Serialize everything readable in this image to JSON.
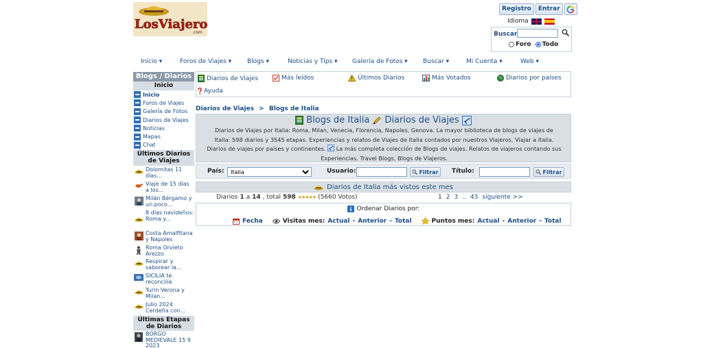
{
  "header": {
    "logo_text": "LosViajeros",
    "logo_sub": ".com",
    "registro": "Registro",
    "entrar": "Entrar",
    "idioma": "Idioma",
    "search_label": "Buscar",
    "search_value": "",
    "radio_foro": "Foro",
    "radio_todo": "Todo"
  },
  "topnav": [
    "Inicio ▾",
    "Foros de Viajes ▾",
    "Blogs ▾",
    "Noticias y Tips ▾",
    "Galería de Fotos ▾",
    "Buscar ▾",
    "Mi Cuenta ▾",
    "Web ▾"
  ],
  "sidebar": {
    "title": "Blogs / Diarios",
    "section_inicio": "Inicio",
    "items": [
      "Inicio",
      "Foros de Viajes",
      "Galería de Fotos",
      "Diarios de Viajes",
      "Noticias",
      "Mapas",
      "Chat"
    ],
    "ultimos_title": "Últimos Diarios de Viajes",
    "diaries": [
      "Dolomitas 11 días...",
      "Viaje de 15 días a los...",
      "Milán Bérgamo y un poco...",
      "8 días navideños: Roma y...",
      "Costa Amalfitana y Nápoles",
      "Roma Orvieto Arezzo",
      "Respirar y saborear la...",
      "SICILIA te reconcilia",
      "Turin Verona y Milan...",
      "Julio 2024 Cerdeña con..."
    ],
    "etapas_title": "Últimas Etapas de Diarios",
    "etapas": [
      "BORGO MEDIEVALE 15 9 2023"
    ]
  },
  "tabs": {
    "diarios": "Diarios de Viajes",
    "leidos": "Más leídos",
    "ultimos": "Últimos Diarios",
    "votados": "Más Votados",
    "paises": "Diarios por países",
    "ayuda": "Ayuda"
  },
  "breadcrumb": {
    "a": "Diarios de Viajes",
    "sep": ">",
    "b": "Blogs de Italia"
  },
  "intro": {
    "title_a": "Blogs de Italia",
    "title_b": "Diarios de Viajes",
    "line1": "Diarios de Viajes por Italia: Roma, Milan, Venecia, Florencia, Napoles, Genova. La mayor biblioteca de blogs de viajes de",
    "line2": "Italia: 598 diarios y 3545 etapas. Experiencias y relatos de Viajes de Italia contados por nuestros Viajeros. Viajar a Italia.",
    "line3a": "Diarios de viajes por países y continentes.",
    "line3b": "La más completa colección de Blogs de viajes. Relatos de viajeros contando sus",
    "line4": "Experiencias. Travel Blogs, Blogs de Viajeros."
  },
  "filter": {
    "pais_label": "País:",
    "pais_value": "Italia",
    "usuario_label": "Usuario:",
    "titulo_label": "Título:",
    "button": "Filtrar"
  },
  "most": {
    "title": "Diarios de Italia más vistos este mes"
  },
  "counts": {
    "diarios": "Diarios",
    "from": "1",
    "a": "a",
    "to": "14",
    "total_label": ", total",
    "total": "598",
    "votes": "(5660 Votos)",
    "pages": [
      "1",
      "2",
      "3",
      "..",
      "43"
    ],
    "next": "siguiente >>"
  },
  "order": {
    "title": "Ordenar Diarios por:",
    "fecha": "Fecha",
    "visitas": "Visitas mes:",
    "puntos": "Puntos mes:",
    "actual": "Actual",
    "anterior": "Anterior",
    "total": "Total",
    "dash": "-"
  },
  "colors": {
    "link": "#1d4f86",
    "header_bar": "#8d9aa9",
    "panel": "#dadfe4"
  }
}
